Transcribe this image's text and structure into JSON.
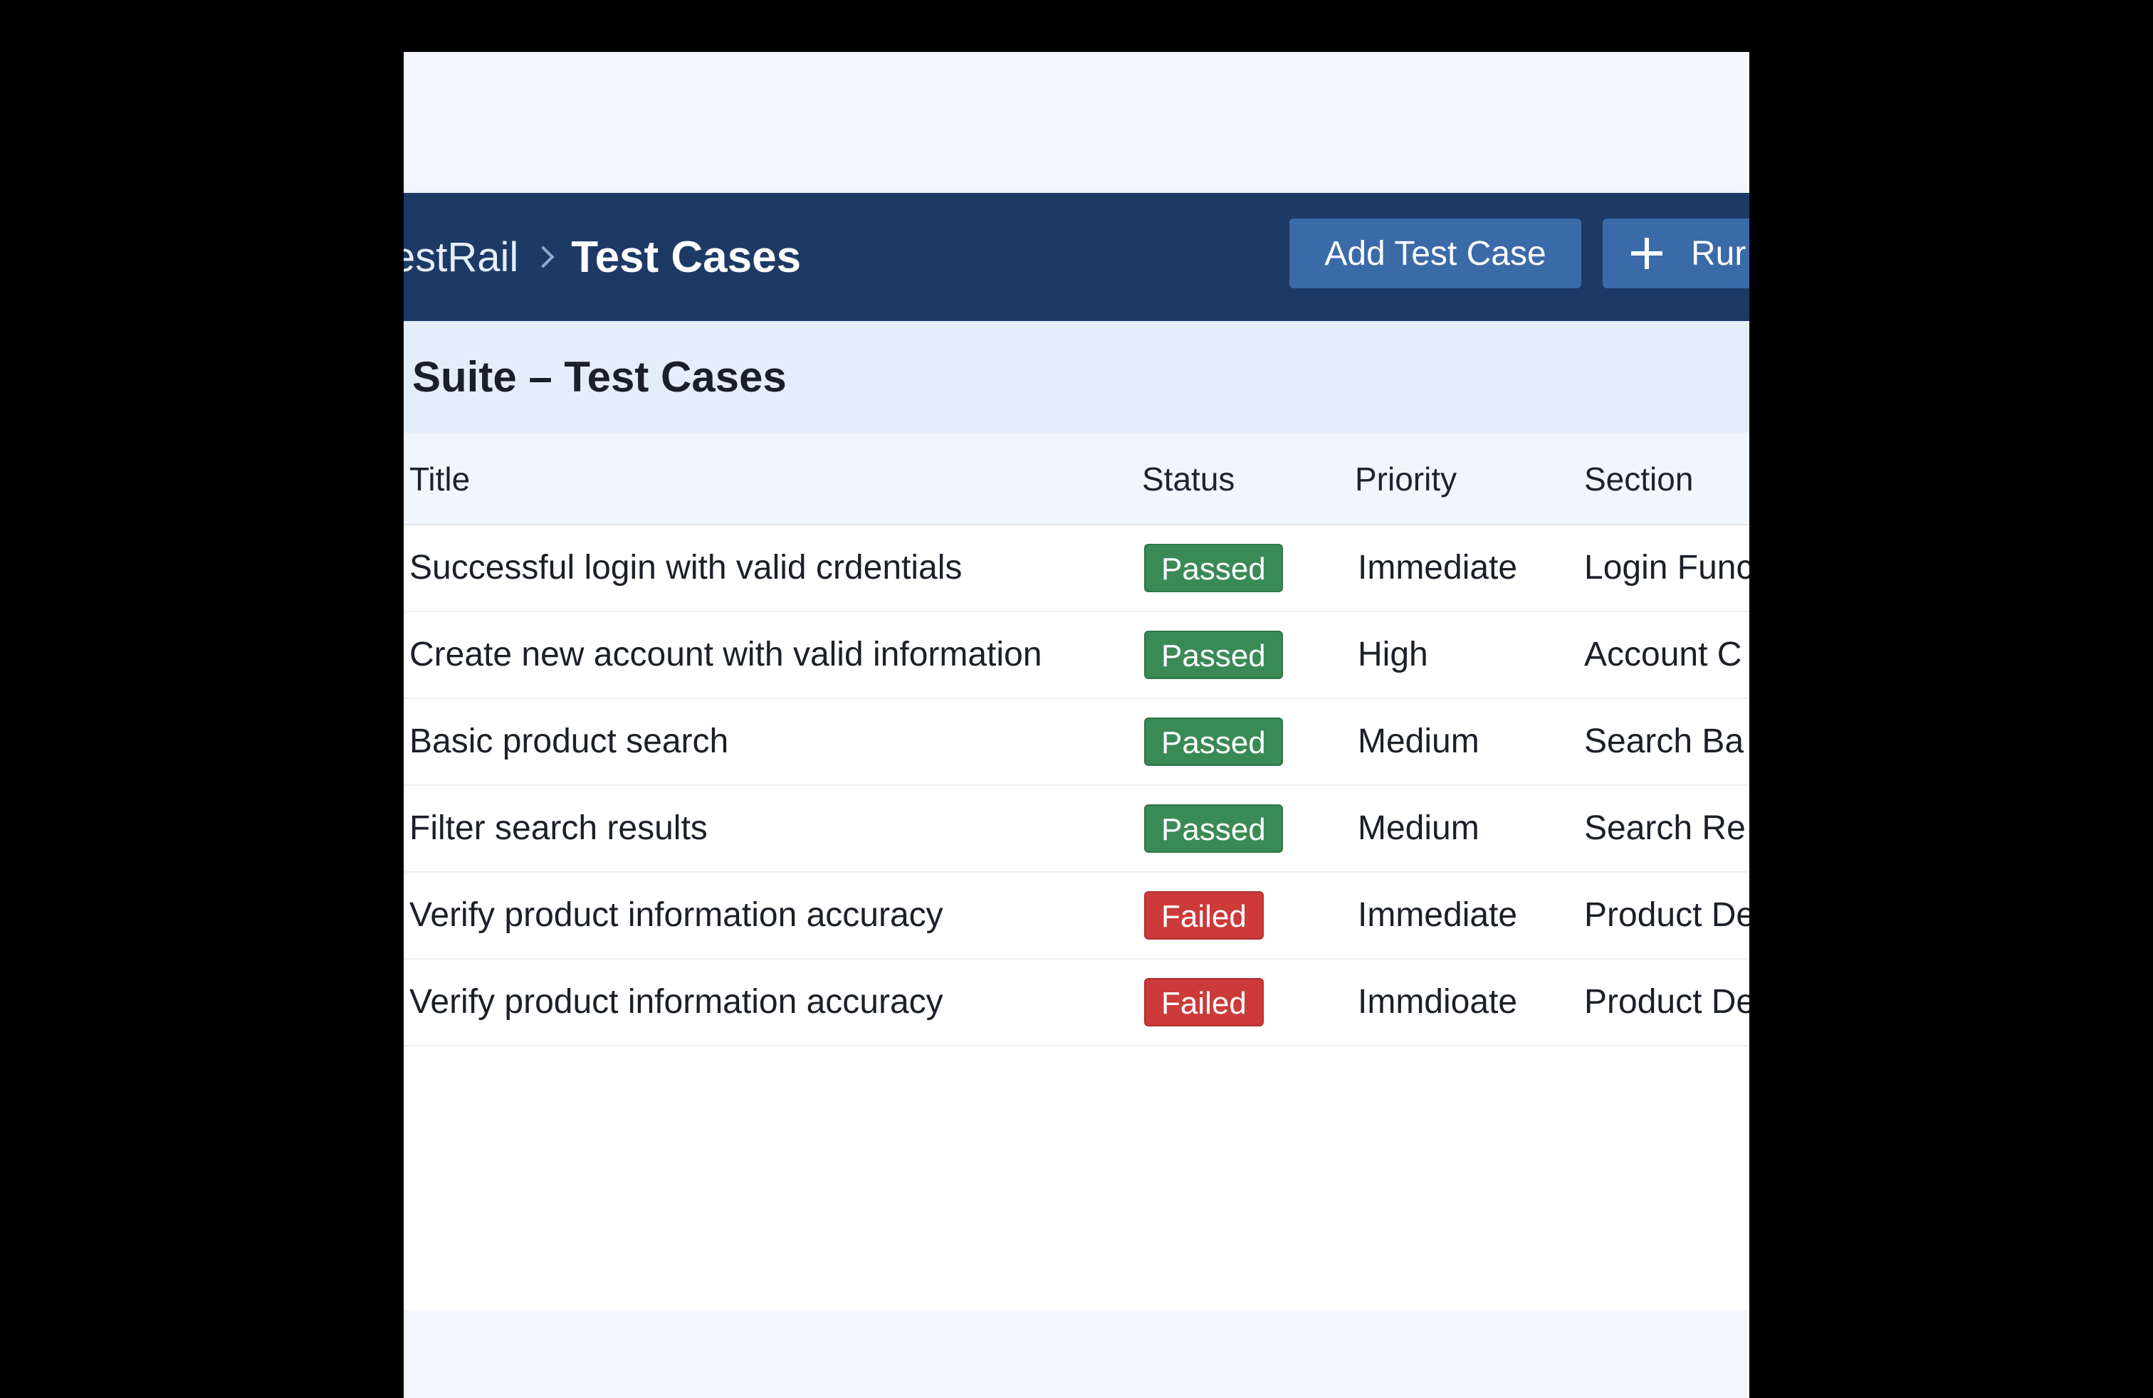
{
  "header": {
    "breadcrumb_root": "estRail",
    "breadcrumb_current": "Test Cases",
    "add_button_label": "Add Test Case",
    "run_button_label": "Rur",
    "colors": {
      "header_bg": "#1d3a66",
      "button_bg": "#3b6aa8"
    }
  },
  "suite": {
    "title": "Suite – Test Cases"
  },
  "table": {
    "columns": {
      "title": "Title",
      "status": "Status",
      "priority": "Priority",
      "section": "Section"
    },
    "rows": [
      {
        "title": "Successful login with valid crdentials",
        "status": "Passed",
        "priority": "Immediate",
        "section": "Login Func"
      },
      {
        "title": "Create new account with valid information",
        "status": "Passed",
        "priority": "High",
        "section": "Account C"
      },
      {
        "title": "Basic product search",
        "status": "Passed",
        "priority": "Medium",
        "section": "Search Ba"
      },
      {
        "title": "Filter search results",
        "status": "Passed",
        "priority": "Medium",
        "section": "Search Re"
      },
      {
        "title": "Verify product information accuracy",
        "status": "Failed",
        "priority": "Immediate",
        "section": "Product De"
      },
      {
        "title": "Verify product information accuracy",
        "status": "Failed",
        "priority": "Immdioate",
        "section": "Product De"
      }
    ]
  },
  "status_colors": {
    "Passed": "#3a8a55",
    "Failed": "#cc3a3a"
  }
}
